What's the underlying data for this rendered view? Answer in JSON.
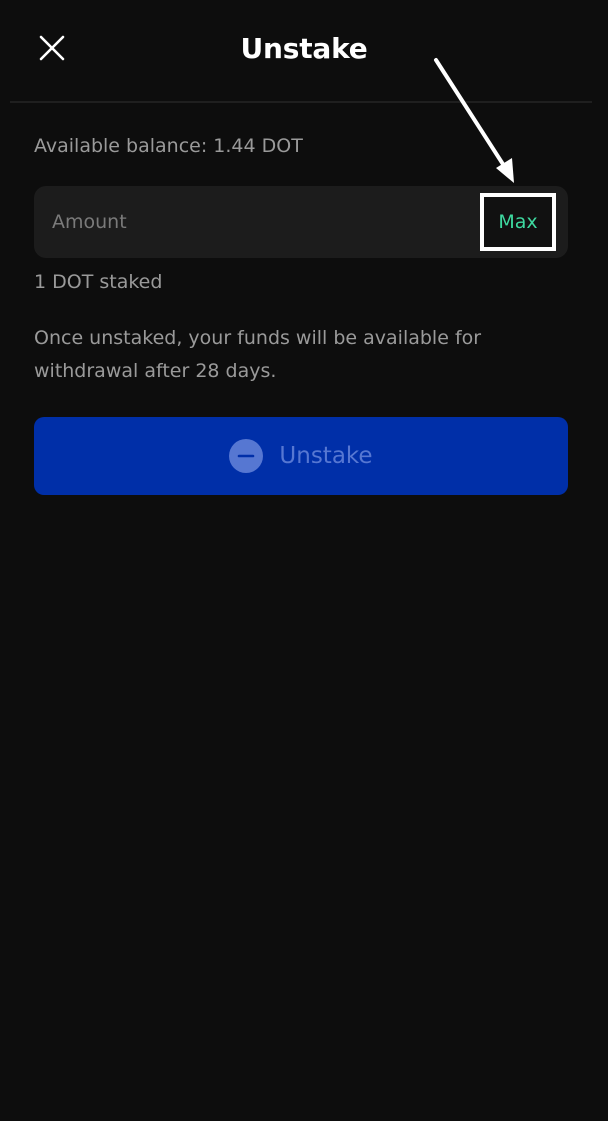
{
  "header": {
    "title": "Unstake",
    "close_icon": "close-icon"
  },
  "balance": {
    "text": "Available balance: 1.44 DOT"
  },
  "amount": {
    "placeholder": "Amount",
    "value": "",
    "max_label": "Max"
  },
  "staked": {
    "text": "1 DOT staked"
  },
  "info": {
    "text": "Once unstaked, your funds will be available for withdrawal after 28 days."
  },
  "action": {
    "label": "Unstake",
    "icon": "minus-circle-icon"
  },
  "colors": {
    "background": "#0d0d0d",
    "input_background": "#1c1c1c",
    "max_text": "#3ed9a0",
    "button_background": "#002fa8",
    "button_text": "#5677d2",
    "muted_text": "#9a9a9a"
  }
}
